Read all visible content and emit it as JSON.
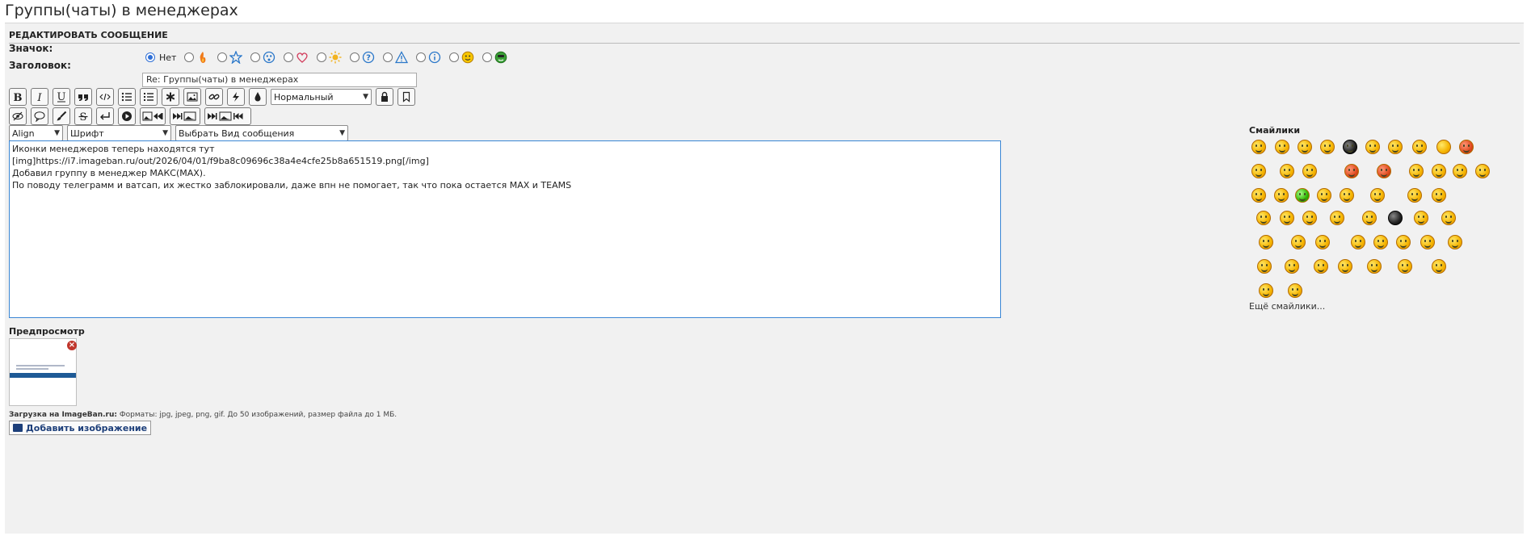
{
  "page": {
    "title": "Группы(чаты) в менеджерах"
  },
  "panel": {
    "header": "РЕДАКТИРОВАТЬ СООБЩЕНИЕ"
  },
  "icon_field": {
    "label": "Значок:",
    "none_label": "Нет",
    "options": [
      "none",
      "fire-icon",
      "star-icon",
      "face-icon",
      "heart-icon",
      "sun-icon",
      "question-icon",
      "warning-icon",
      "info-icon",
      "smile-icon",
      "alien-icon"
    ],
    "selected": "none"
  },
  "subject_field": {
    "label": "Заголовок:",
    "value": "Re: Группы(чаты) в менеджерах"
  },
  "toolbar": {
    "size_select": "Нормальный",
    "align_select": "Align",
    "font_select": "Шрифт",
    "type_select": "Выбрать Вид сообщения"
  },
  "editor": {
    "lines": [
      "Иконки менеджеров теперь находятся тут",
      "[img]https://i7.imageban.ru/out/2026/04/01/f9ba8c09696c38a4e4cfe25b8a651519.png[/img]",
      "Добавил группу в менеджер МАКС(MAX).",
      "По поводу телеграмм и ватсап, их жестко заблокировали, даже впн не помогает, так что пока остается MAX и TEAMS"
    ]
  },
  "smiles": {
    "title": "Смайлики",
    "more": "Ещё смайлики..."
  },
  "preview": {
    "label": "Предпросмотр"
  },
  "upload": {
    "site_label": "Загрузка на ImageBan.ru:",
    "info": " Форматы: jpg, jpeg, png, gif. До 50 изображений, размер файла до 1 МБ.",
    "add_button": "Добавить изображение"
  }
}
